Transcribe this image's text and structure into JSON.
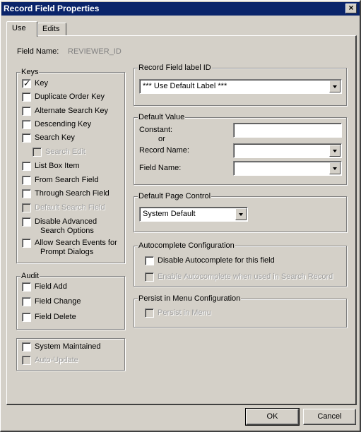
{
  "window": {
    "title": "Record Field Properties",
    "close_glyph": "✕"
  },
  "tabs": [
    {
      "label": "Use",
      "active": true
    },
    {
      "label": "Edits",
      "active": false
    }
  ],
  "field_name": {
    "label": "Field Name:",
    "value": "REVIEWER_ID"
  },
  "keys": {
    "title": "Keys",
    "items": [
      {
        "label": "Key",
        "checked": true,
        "disabled": false
      },
      {
        "label": "Duplicate Order Key",
        "checked": false,
        "disabled": false
      },
      {
        "label": "Alternate Search Key",
        "checked": false,
        "disabled": false
      },
      {
        "label": "Descending Key",
        "checked": false,
        "disabled": false
      },
      {
        "label": "Search Key",
        "checked": false,
        "disabled": false
      },
      {
        "label": "Search Edit",
        "checked": false,
        "disabled": true
      },
      {
        "label": "List Box Item",
        "checked": false,
        "disabled": false
      },
      {
        "label": "From Search Field",
        "checked": false,
        "disabled": false
      },
      {
        "label": "Through Search Field",
        "checked": false,
        "disabled": false
      },
      {
        "label": "Default Search Field",
        "checked": false,
        "disabled": true
      },
      {
        "label": "Disable Advanced",
        "label2": "Search Options",
        "checked": false,
        "disabled": false
      },
      {
        "label": "Allow Search Events for",
        "label2": "Prompt Dialogs",
        "checked": false,
        "disabled": false
      }
    ]
  },
  "audit": {
    "title": "Audit",
    "items": [
      {
        "label": "Field Add",
        "checked": false
      },
      {
        "label": "Field Change",
        "checked": false
      },
      {
        "label": "Field Delete",
        "checked": false
      }
    ]
  },
  "system": {
    "items": [
      {
        "label": "System Maintained",
        "checked": false,
        "disabled": false
      },
      {
        "label": "Auto-Update",
        "checked": false,
        "disabled": true
      }
    ]
  },
  "label_id": {
    "title": "Record Field label ID",
    "selected": "*** Use Default Label ***"
  },
  "default_value": {
    "title": "Default Value",
    "constant_label": "Constant:",
    "constant_value": "",
    "or_label": "or",
    "record_name_label": "Record Name:",
    "record_name_value": "",
    "field_name_label": "Field Name:",
    "field_name_value": ""
  },
  "page_control": {
    "title": "Default Page Control",
    "selected": "System Default"
  },
  "autocomplete": {
    "title": "Autocomplete Configuration",
    "items": [
      {
        "label": "Disable Autocomplete for this field",
        "checked": false,
        "disabled": false
      },
      {
        "label": "Enable Autocomplete when used in Search Record",
        "checked": false,
        "disabled": true
      }
    ]
  },
  "persist": {
    "title": "Persist in Menu Configuration",
    "items": [
      {
        "label": "Persist in Menu",
        "checked": false,
        "disabled": true
      }
    ]
  },
  "buttons": {
    "ok": "OK",
    "cancel": "Cancel"
  },
  "colors": {
    "titlebar": "#0a246a",
    "face": "#d4d0c8",
    "disabled_text": "#a0a0a0"
  }
}
